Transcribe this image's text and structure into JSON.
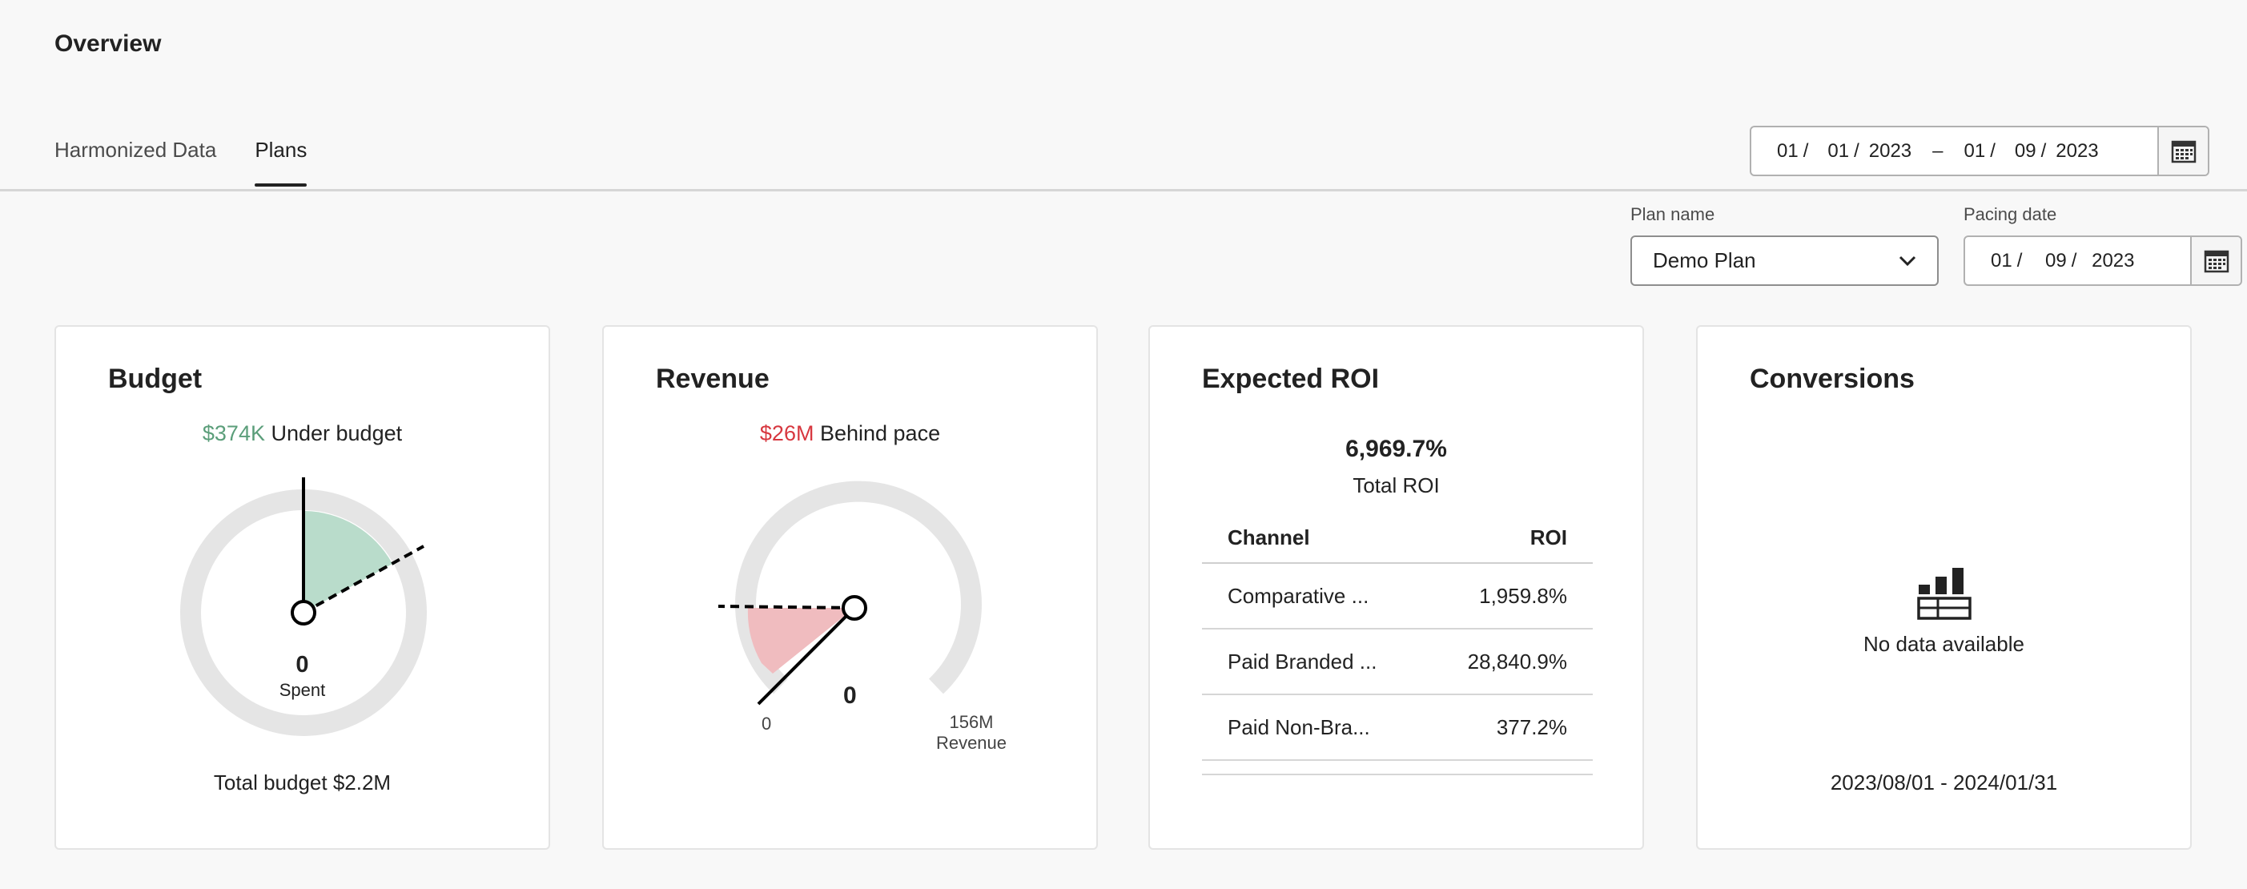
{
  "header": {
    "title": "Overview"
  },
  "tabs": [
    {
      "label": "Harmonized Data"
    },
    {
      "label": "Plans"
    }
  ],
  "date_range": {
    "start_mm": "01",
    "start_dd": "01",
    "start_yyyy": "2023",
    "sep": "–",
    "end_mm": "01",
    "end_dd": "09",
    "end_yyyy": "2023"
  },
  "filters": {
    "plan_label": "Plan name",
    "plan_value": "Demo Plan",
    "pacing_label": "Pacing date",
    "pacing_mm": "01",
    "pacing_dd": "09",
    "pacing_yyyy": "2023"
  },
  "budget": {
    "title": "Budget",
    "delta": "$374K",
    "status": "Under budget",
    "spent_value": "0",
    "spent_label": "Spent",
    "total": "Total budget $2.2M"
  },
  "revenue": {
    "title": "Revenue",
    "delta": "$26M",
    "status": "Behind pace",
    "value": "0",
    "min_label": "0",
    "max_label": "156M",
    "max_caption": "Revenue"
  },
  "roi": {
    "title": "Expected ROI",
    "total": "6,969.7%",
    "total_label": "Total ROI",
    "col_channel": "Channel",
    "col_roi": "ROI",
    "rows": [
      {
        "channel": "Comparative ...",
        "roi": "1,959.8%"
      },
      {
        "channel": "Paid Branded ...",
        "roi": "28,840.9%"
      },
      {
        "channel": "Paid Non-Bra...",
        "roi": "377.2%"
      }
    ]
  },
  "conversions": {
    "title": "Conversions",
    "empty": "No data available",
    "range": "2023/08/01 - 2024/01/31"
  },
  "colors": {
    "green": "#5b9e7a",
    "green_fill": "#b9dccb",
    "red": "#d7373f",
    "red_fill": "#f0bcbf",
    "track": "#e5e5e5"
  },
  "icons": {
    "calendar": "calendar-icon",
    "chevron": "chevron-down-icon",
    "nodata": "bar-chart-table-icon"
  }
}
